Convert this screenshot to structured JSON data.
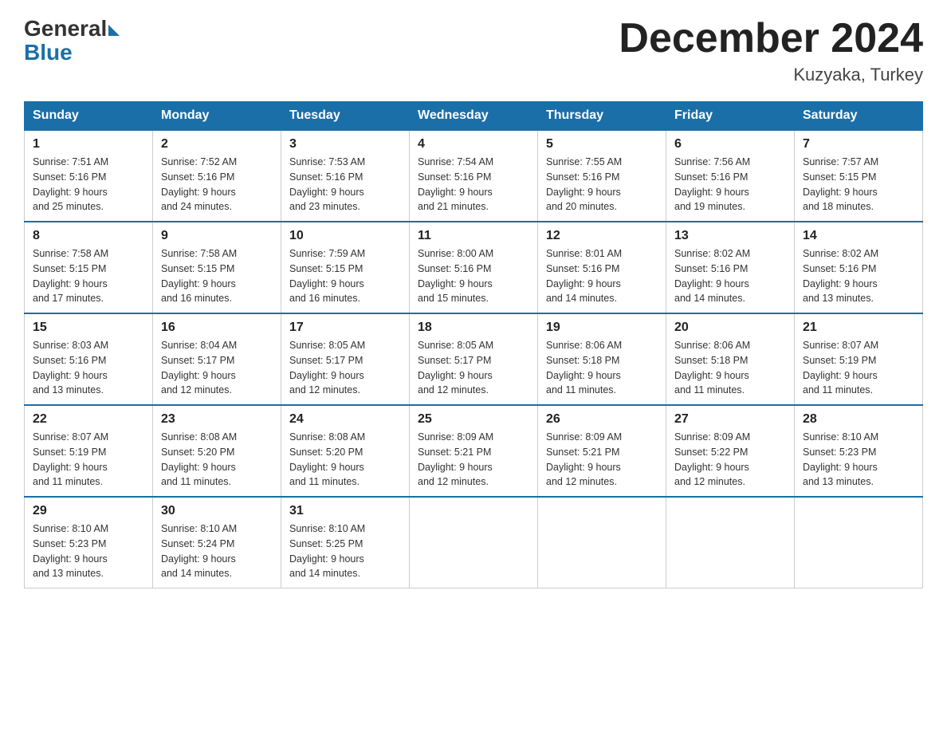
{
  "header": {
    "logo_general": "General",
    "logo_blue": "Blue",
    "month_title": "December 2024",
    "location": "Kuzyaka, Turkey"
  },
  "weekdays": [
    "Sunday",
    "Monday",
    "Tuesday",
    "Wednesday",
    "Thursday",
    "Friday",
    "Saturday"
  ],
  "weeks": [
    [
      {
        "day": "1",
        "sunrise": "7:51 AM",
        "sunset": "5:16 PM",
        "daylight": "9 hours and 25 minutes."
      },
      {
        "day": "2",
        "sunrise": "7:52 AM",
        "sunset": "5:16 PM",
        "daylight": "9 hours and 24 minutes."
      },
      {
        "day": "3",
        "sunrise": "7:53 AM",
        "sunset": "5:16 PM",
        "daylight": "9 hours and 23 minutes."
      },
      {
        "day": "4",
        "sunrise": "7:54 AM",
        "sunset": "5:16 PM",
        "daylight": "9 hours and 21 minutes."
      },
      {
        "day": "5",
        "sunrise": "7:55 AM",
        "sunset": "5:16 PM",
        "daylight": "9 hours and 20 minutes."
      },
      {
        "day": "6",
        "sunrise": "7:56 AM",
        "sunset": "5:16 PM",
        "daylight": "9 hours and 19 minutes."
      },
      {
        "day": "7",
        "sunrise": "7:57 AM",
        "sunset": "5:15 PM",
        "daylight": "9 hours and 18 minutes."
      }
    ],
    [
      {
        "day": "8",
        "sunrise": "7:58 AM",
        "sunset": "5:15 PM",
        "daylight": "9 hours and 17 minutes."
      },
      {
        "day": "9",
        "sunrise": "7:58 AM",
        "sunset": "5:15 PM",
        "daylight": "9 hours and 16 minutes."
      },
      {
        "day": "10",
        "sunrise": "7:59 AM",
        "sunset": "5:15 PM",
        "daylight": "9 hours and 16 minutes."
      },
      {
        "day": "11",
        "sunrise": "8:00 AM",
        "sunset": "5:16 PM",
        "daylight": "9 hours and 15 minutes."
      },
      {
        "day": "12",
        "sunrise": "8:01 AM",
        "sunset": "5:16 PM",
        "daylight": "9 hours and 14 minutes."
      },
      {
        "day": "13",
        "sunrise": "8:02 AM",
        "sunset": "5:16 PM",
        "daylight": "9 hours and 14 minutes."
      },
      {
        "day": "14",
        "sunrise": "8:02 AM",
        "sunset": "5:16 PM",
        "daylight": "9 hours and 13 minutes."
      }
    ],
    [
      {
        "day": "15",
        "sunrise": "8:03 AM",
        "sunset": "5:16 PM",
        "daylight": "9 hours and 13 minutes."
      },
      {
        "day": "16",
        "sunrise": "8:04 AM",
        "sunset": "5:17 PM",
        "daylight": "9 hours and 12 minutes."
      },
      {
        "day": "17",
        "sunrise": "8:05 AM",
        "sunset": "5:17 PM",
        "daylight": "9 hours and 12 minutes."
      },
      {
        "day": "18",
        "sunrise": "8:05 AM",
        "sunset": "5:17 PM",
        "daylight": "9 hours and 12 minutes."
      },
      {
        "day": "19",
        "sunrise": "8:06 AM",
        "sunset": "5:18 PM",
        "daylight": "9 hours and 11 minutes."
      },
      {
        "day": "20",
        "sunrise": "8:06 AM",
        "sunset": "5:18 PM",
        "daylight": "9 hours and 11 minutes."
      },
      {
        "day": "21",
        "sunrise": "8:07 AM",
        "sunset": "5:19 PM",
        "daylight": "9 hours and 11 minutes."
      }
    ],
    [
      {
        "day": "22",
        "sunrise": "8:07 AM",
        "sunset": "5:19 PM",
        "daylight": "9 hours and 11 minutes."
      },
      {
        "day": "23",
        "sunrise": "8:08 AM",
        "sunset": "5:20 PM",
        "daylight": "9 hours and 11 minutes."
      },
      {
        "day": "24",
        "sunrise": "8:08 AM",
        "sunset": "5:20 PM",
        "daylight": "9 hours and 11 minutes."
      },
      {
        "day": "25",
        "sunrise": "8:09 AM",
        "sunset": "5:21 PM",
        "daylight": "9 hours and 12 minutes."
      },
      {
        "day": "26",
        "sunrise": "8:09 AM",
        "sunset": "5:21 PM",
        "daylight": "9 hours and 12 minutes."
      },
      {
        "day": "27",
        "sunrise": "8:09 AM",
        "sunset": "5:22 PM",
        "daylight": "9 hours and 12 minutes."
      },
      {
        "day": "28",
        "sunrise": "8:10 AM",
        "sunset": "5:23 PM",
        "daylight": "9 hours and 13 minutes."
      }
    ],
    [
      {
        "day": "29",
        "sunrise": "8:10 AM",
        "sunset": "5:23 PM",
        "daylight": "9 hours and 13 minutes."
      },
      {
        "day": "30",
        "sunrise": "8:10 AM",
        "sunset": "5:24 PM",
        "daylight": "9 hours and 14 minutes."
      },
      {
        "day": "31",
        "sunrise": "8:10 AM",
        "sunset": "5:25 PM",
        "daylight": "9 hours and 14 minutes."
      },
      null,
      null,
      null,
      null
    ]
  ],
  "labels": {
    "sunrise": "Sunrise:",
    "sunset": "Sunset:",
    "daylight": "Daylight:"
  }
}
